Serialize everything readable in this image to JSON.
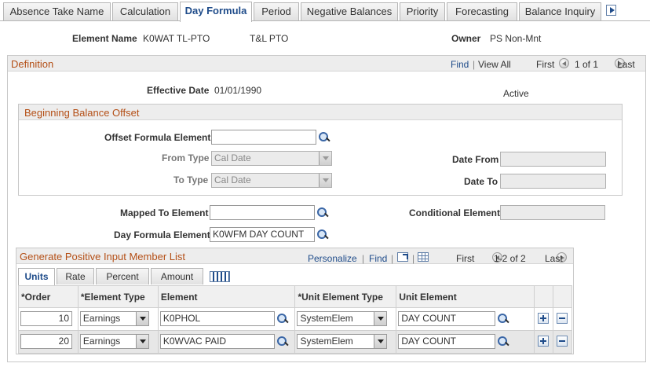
{
  "tabs": [
    {
      "label": "Absence Take Name",
      "active": false
    },
    {
      "label": "Calculation",
      "active": false
    },
    {
      "label": "Day Formula",
      "active": true
    },
    {
      "label": "Period",
      "active": false
    },
    {
      "label": "Negative Balances",
      "active": false
    },
    {
      "label": "Priority",
      "active": false
    },
    {
      "label": "Forecasting",
      "active": false
    },
    {
      "label": "Balance Inquiry",
      "active": false
    }
  ],
  "header": {
    "element_name_label": "Element Name",
    "element_name_value": "K0WAT TL-PTO",
    "element_desc": "T&L PTO",
    "owner_label": "Owner",
    "owner_value": "PS Non-Mnt"
  },
  "definition": {
    "title": "Definition",
    "find": "Find",
    "view_all": "View All",
    "first": "First",
    "range": "1 of 1",
    "last": "Last",
    "effective_date_label": "Effective Date",
    "effective_date_value": "01/01/1990",
    "status": "Active"
  },
  "offset": {
    "title": "Beginning Balance Offset",
    "formula_element_label": "Offset Formula Element",
    "formula_element_value": "",
    "from_type_label": "From Type",
    "from_type_value": "Cal Date",
    "to_type_label": "To Type",
    "to_type_value": "Cal Date",
    "date_from_label": "Date From",
    "date_from_value": "",
    "date_to_label": "Date To",
    "date_to_value": ""
  },
  "mapping": {
    "mapped_to_label": "Mapped To Element",
    "mapped_to_value": "",
    "conditional_label": "Conditional Element",
    "conditional_value": "",
    "day_formula_label": "Day Formula Element",
    "day_formula_value": "K0WFM DAY COUNT"
  },
  "members": {
    "title": "Generate Positive Input Member List",
    "personalize": "Personalize",
    "find": "Find",
    "first": "First",
    "range": "1-2 of 2",
    "last": "Last",
    "tabs": [
      {
        "label": "Units",
        "active": true
      },
      {
        "label": "Rate",
        "active": false
      },
      {
        "label": "Percent",
        "active": false
      },
      {
        "label": "Amount",
        "active": false
      }
    ],
    "columns": [
      "*Order",
      "*Element Type",
      "Element",
      "*Unit Element Type",
      "Unit Element"
    ],
    "rows": [
      {
        "order": "10",
        "element_type": "Earnings",
        "element": "K0PHOL",
        "unit_element_type": "SystemElem",
        "unit_element": "DAY COUNT"
      },
      {
        "order": "20",
        "element_type": "Earnings",
        "element": "K0WVAC PAID",
        "unit_element_type": "SystemElem",
        "unit_element": "DAY COUNT"
      }
    ]
  }
}
